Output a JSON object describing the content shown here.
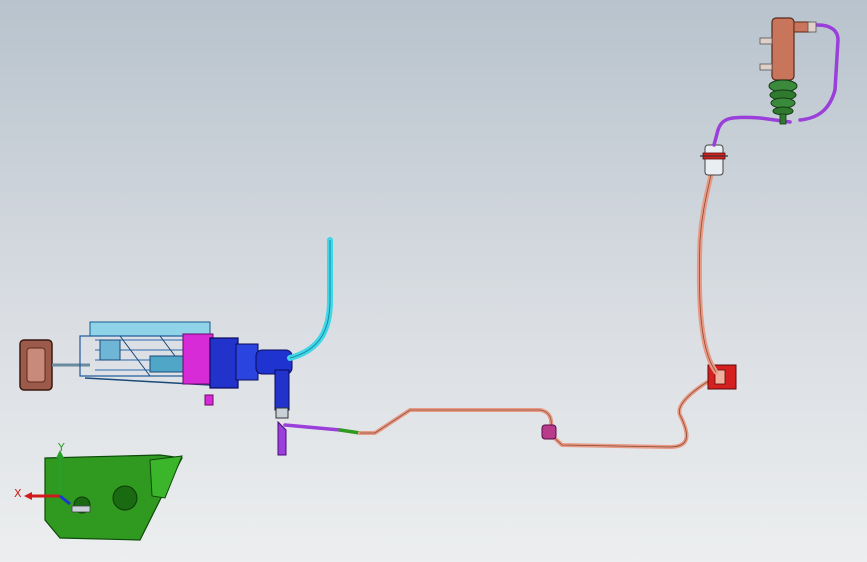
{
  "viewport": {
    "background_top": "#b8c3cd",
    "background_bottom": "#eceeef"
  },
  "triad": {
    "x_label": "X",
    "y_label": "Y",
    "x_color": "#d11a1a",
    "y_color": "#2aa02a",
    "z_color": "#1a37d1"
  },
  "colors": {
    "reservoir_hose": "#3fd6e8",
    "line_salmon": "#e89a85",
    "line_purple": "#9a3fd9",
    "bracket_green": "#2f9a1f",
    "master_cylinder_blue": "#2233cc",
    "flange_magenta": "#d62bd6",
    "slave_cylinder_copper": "#c9755b",
    "boot_green": "#3b8a3b",
    "pedal_brown": "#9b5a4a"
  }
}
